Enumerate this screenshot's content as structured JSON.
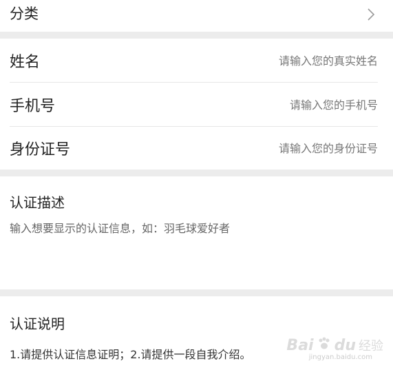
{
  "category": {
    "label": "分类",
    "chevron_icon": "chevron-right-icon"
  },
  "form": {
    "name": {
      "label": "姓名",
      "placeholder": "请输入您的真实姓名"
    },
    "phone": {
      "label": "手机号",
      "placeholder": "请输入您的手机号"
    },
    "id_number": {
      "label": "身份证号",
      "placeholder": "请输入您的身份证号"
    }
  },
  "description": {
    "title": "认证描述",
    "placeholder": "输入想要显示的认证信息，如：羽毛球爱好者"
  },
  "instructions": {
    "title": "认证说明",
    "text": "1.请提供认证信息证明；2.请提供一段自我介绍。"
  },
  "watermark": {
    "brand": "Bai",
    "brand_suffix": "du",
    "cn": "经验",
    "sub": "jingyan.baidu.com"
  },
  "colors": {
    "background": "#f2f2f2",
    "card": "#ffffff",
    "placeholder": "#777777",
    "divider": "#e6e6e6"
  }
}
